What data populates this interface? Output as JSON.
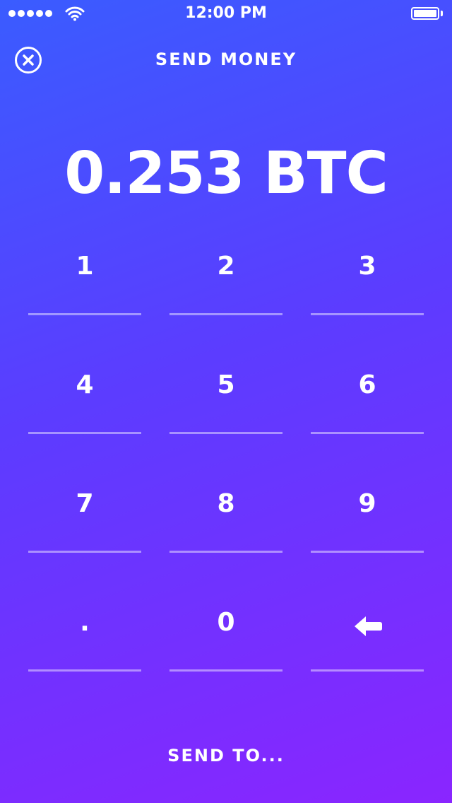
{
  "status_bar": {
    "time": "12:00 PM",
    "signal_icon": "signal-dots-icon",
    "wifi_icon": "wifi-icon",
    "battery_icon": "battery-icon",
    "battery_level": 1.0
  },
  "header": {
    "title": "SEND MONEY",
    "close_icon": "close-circle-icon"
  },
  "amount": {
    "display": "0.253 BTC"
  },
  "keypad": {
    "keys": [
      {
        "label": "1"
      },
      {
        "label": "2"
      },
      {
        "label": "3"
      },
      {
        "label": "4"
      },
      {
        "label": "5"
      },
      {
        "label": "6"
      },
      {
        "label": "7"
      },
      {
        "label": "8"
      },
      {
        "label": "9"
      },
      {
        "label": "."
      },
      {
        "label": "0"
      },
      {
        "label": "",
        "icon": "backspace-arrow-icon"
      }
    ]
  },
  "footer": {
    "send_label": "SEND TO..."
  },
  "colors": {
    "gradient_start": "#3a5cff",
    "gradient_mid": "#5c3cff",
    "gradient_end": "#8a25ff",
    "text": "#ffffff"
  }
}
